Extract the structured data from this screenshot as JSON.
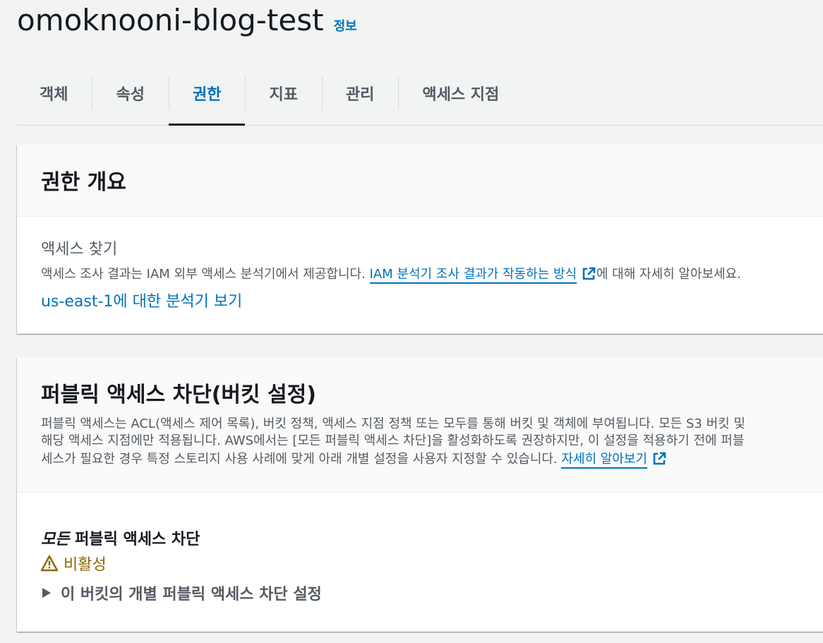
{
  "header": {
    "bucket_name": "omoknooni-blog-test",
    "info_link": "정보"
  },
  "tabs": [
    {
      "label": "객체",
      "active": false
    },
    {
      "label": "속성",
      "active": false
    },
    {
      "label": "권한",
      "active": true
    },
    {
      "label": "지표",
      "active": false
    },
    {
      "label": "관리",
      "active": false
    },
    {
      "label": "액세스 지점",
      "active": false
    }
  ],
  "permissions_overview": {
    "title": "권한 개요",
    "access_finding_heading": "액세스 찾기",
    "description_prefix": "액세스 조사 결과는 IAM 외부 액세스 분석기에서 제공합니다. ",
    "description_link": "IAM 분석기 조사 결과가 작동하는 방식",
    "description_suffix": "에 대해 자세히 알아보세요.",
    "analyzer_link": "us-east-1에 대한 분석기 보기"
  },
  "block_public_access": {
    "title": "퍼블릭 액세스 차단(버킷 설정)",
    "description_lines": [
      "퍼블릭 액세스는 ACL(액세스 제어 목록), 버킷 정책, 액세스 지점 정책 또는 모두를 통해 버킷 및 객체에 부여됩니다. 모든 S3 버킷 및",
      "해당 액세스 지점에만 적용됩니다. AWS에서는 [모든 퍼블릭 액세스 차단]을 활성화하도록 권장하지만, 이 설정을 적용하기 전에 퍼블",
      "세스가 필요한 경우 특정 스토리지 사용 사례에 맞게 아래 개별 설정을 사용자 지정할 수 있습니다. "
    ],
    "learn_more_link": "자세히 알아보기",
    "setting_label_em": "모든",
    "setting_label_rest": " 퍼블릭 액세스 차단",
    "status": "비활성",
    "status_icon": "warning-icon",
    "expander_label": "이 버킷의 개별 퍼블릭 액세스 차단 설정"
  },
  "colors": {
    "link": "#0073bb",
    "warning": "#8d6605",
    "text": "#16191f",
    "muted": "#545b64"
  }
}
